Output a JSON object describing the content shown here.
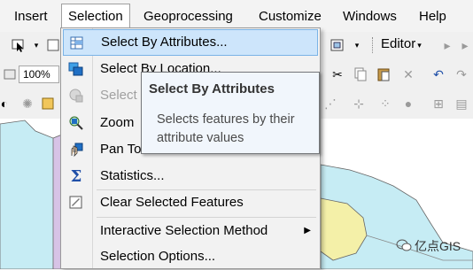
{
  "menubar": {
    "items": [
      {
        "label": "Insert"
      },
      {
        "label": "Selection"
      },
      {
        "label": "Geoprocessing"
      },
      {
        "label": "Customize"
      },
      {
        "label": "Windows"
      },
      {
        "label": "Help"
      }
    ]
  },
  "toolbar": {
    "zoom_value": "100%",
    "editor_label": "Editor"
  },
  "selection_menu": {
    "items": [
      {
        "label": "Select By Attributes...",
        "icon": "table-select-icon"
      },
      {
        "label": "Select By Location...",
        "icon": "select-by-location-icon"
      },
      {
        "label": "Select",
        "icon": "select-by-graphics-icon"
      },
      {
        "label": "Zoom",
        "icon": "zoom-to-selected-icon"
      },
      {
        "label": "Pan To",
        "icon": "pan-to-selected-icon"
      },
      {
        "label": "Statistics...",
        "icon": "sigma-icon"
      },
      {
        "label": "Clear Selected Features",
        "icon": "clear-selection-icon"
      },
      {
        "label": "Interactive Selection Method",
        "icon": ""
      },
      {
        "label": "Selection Options...",
        "icon": ""
      }
    ]
  },
  "tooltip": {
    "title": "Select By Attributes",
    "body": "Selects features by their attribute values"
  },
  "watermark": {
    "text": "亿点GIS"
  },
  "colors": {
    "highlight_bg": "#cde5fb",
    "highlight_border": "#7ab3e6",
    "tooltip_bg": "#f1f6fc",
    "map_blue": "#c6ecf4",
    "map_lilac": "#d7c3e6",
    "map_yellow": "#f4f0a8"
  }
}
